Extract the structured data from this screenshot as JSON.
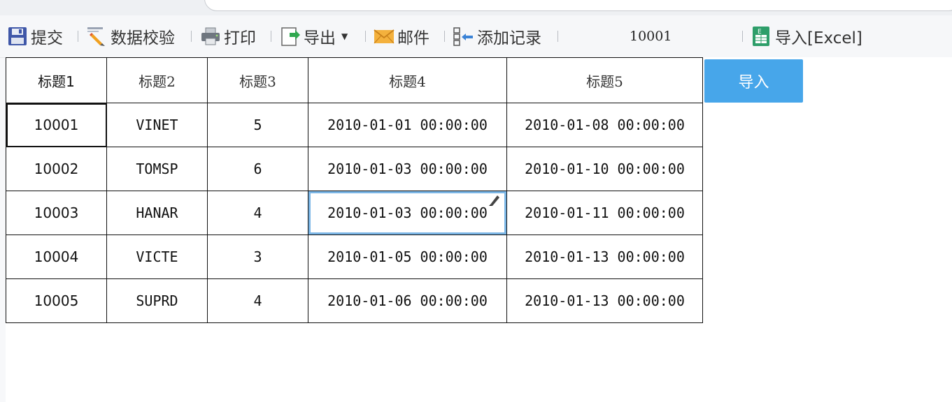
{
  "toolbar": {
    "items": [
      {
        "label": "提交",
        "icon": "save-icon"
      },
      {
        "label": "数据校验",
        "icon": "data-validate-icon"
      },
      {
        "label": "打印",
        "icon": "print-icon"
      },
      {
        "label": "导出",
        "icon": "export-icon"
      },
      {
        "label": "邮件",
        "icon": "mail-icon"
      },
      {
        "label": "添加记录",
        "icon": "add-record-icon"
      },
      {
        "label": "导入[Excel]",
        "icon": "excel-icon"
      }
    ],
    "value_field": "10001"
  },
  "table": {
    "headers": [
      "标题1",
      "标题2",
      "标题3",
      "标题4",
      "标题5"
    ],
    "rows": [
      [
        "10001",
        "VINET",
        "5",
        "2010-01-01 00:00:00",
        "2010-01-08 00:00:00"
      ],
      [
        "10002",
        "TOMSP",
        "6",
        "2010-01-03 00:00:00",
        "2010-01-10 00:00:00"
      ],
      [
        "10003",
        "HANAR",
        "4",
        "2010-01-03 00:00:00",
        "2010-01-11 00:00:00"
      ],
      [
        "10004",
        "VICTE",
        "3",
        "2010-01-05 00:00:00",
        "2010-01-13 00:00:00"
      ],
      [
        "10005",
        "SUPRD",
        "4",
        "2010-01-06 00:00:00",
        "2010-01-13 00:00:00"
      ]
    ]
  },
  "import_button": {
    "label": "导入"
  },
  "colors": {
    "accent": "#47a6ea",
    "edit_highlight": "#7bb6e6"
  }
}
